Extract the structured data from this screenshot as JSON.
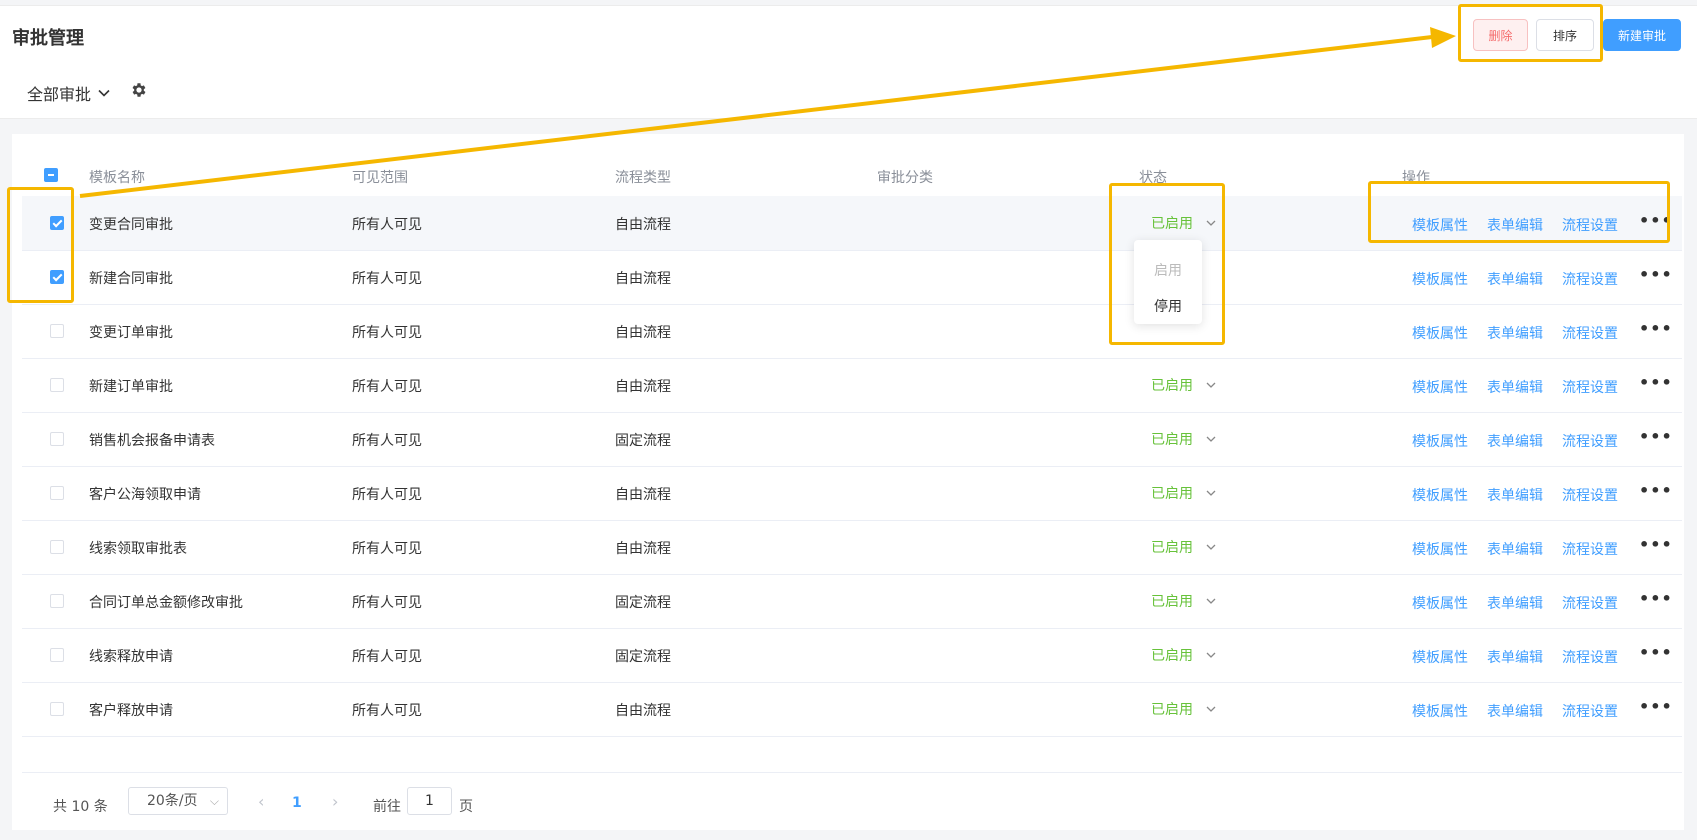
{
  "header": {
    "title": "审批管理",
    "delete_label": "删除",
    "sort_label": "排序",
    "new_label": "新建审批"
  },
  "filter": {
    "selected": "全部审批"
  },
  "table": {
    "columns": [
      "模板名称",
      "可见范围",
      "流程类型",
      "审批分类",
      "状态",
      "操作"
    ],
    "rows": [
      {
        "name": "变更合同审批",
        "scope": "所有人可见",
        "flow": "自由流程",
        "category": "",
        "status": "已启用",
        "checked": true
      },
      {
        "name": "新建合同审批",
        "scope": "所有人可见",
        "flow": "自由流程",
        "category": "",
        "status": "",
        "checked": true
      },
      {
        "name": "变更订单审批",
        "scope": "所有人可见",
        "flow": "自由流程",
        "category": "",
        "status": "",
        "checked": false
      },
      {
        "name": "新建订单审批",
        "scope": "所有人可见",
        "flow": "自由流程",
        "category": "",
        "status": "已启用",
        "checked": false
      },
      {
        "name": "销售机会报备申请表",
        "scope": "所有人可见",
        "flow": "固定流程",
        "category": "",
        "status": "已启用",
        "checked": false
      },
      {
        "name": "客户公海领取申请",
        "scope": "所有人可见",
        "flow": "自由流程",
        "category": "",
        "status": "已启用",
        "checked": false
      },
      {
        "name": "线索领取审批表",
        "scope": "所有人可见",
        "flow": "自由流程",
        "category": "",
        "status": "已启用",
        "checked": false
      },
      {
        "name": "合同订单总金额修改审批",
        "scope": "所有人可见",
        "flow": "固定流程",
        "category": "",
        "status": "已启用",
        "checked": false
      },
      {
        "name": "线索释放申请",
        "scope": "所有人可见",
        "flow": "固定流程",
        "category": "",
        "status": "已启用",
        "checked": false
      },
      {
        "name": "客户释放申请",
        "scope": "所有人可见",
        "flow": "自由流程",
        "category": "",
        "status": "已启用",
        "checked": false
      }
    ],
    "actions": {
      "template_props": "模板属性",
      "form_edit": "表单编辑",
      "flow_settings": "流程设置",
      "more": "•••"
    }
  },
  "status_dropdown": {
    "enable": "启用",
    "disable": "停用"
  },
  "pagination": {
    "total": "共 10 条",
    "page_size": "20条/页",
    "current_page": "1",
    "goto_label": "前往",
    "goto_value": "1",
    "page_suffix": "页"
  },
  "colors": {
    "primary": "#409eff",
    "success": "#67c23a",
    "danger": "#f56c6c",
    "annotation": "#f5b700"
  }
}
